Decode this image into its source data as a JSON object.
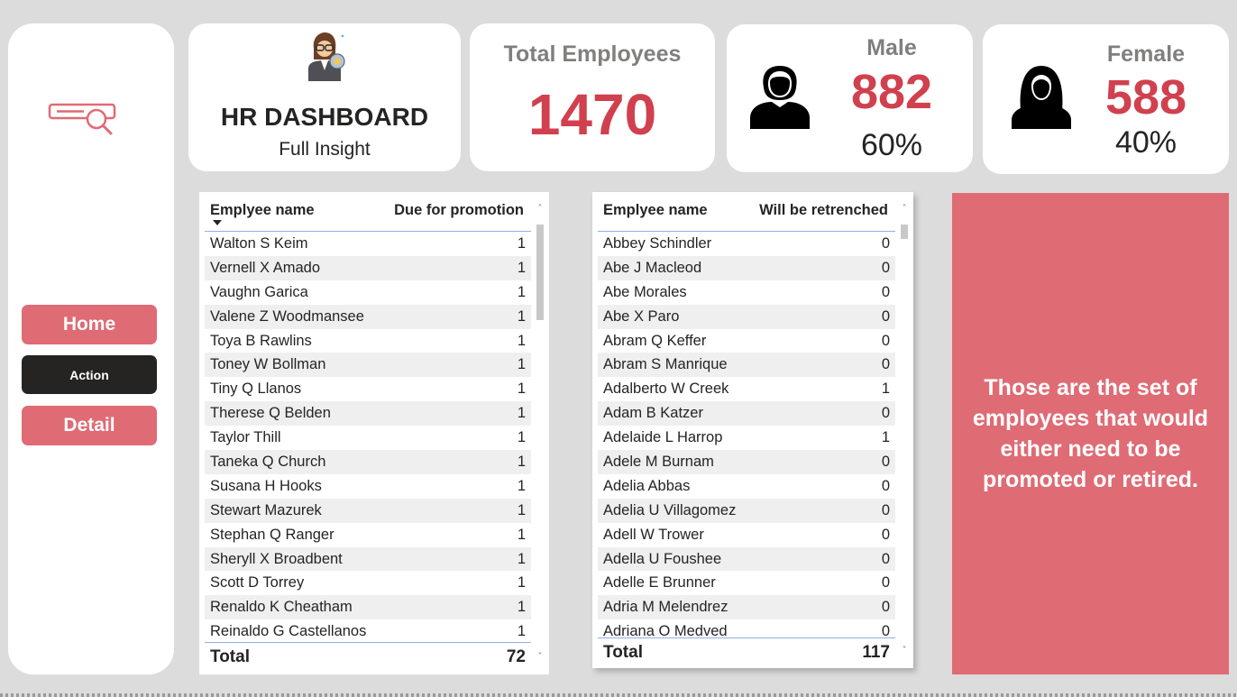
{
  "colors": {
    "accent": "#df6b74",
    "value_red": "#d0404e",
    "dark": "#252423",
    "background": "#dcdcdc"
  },
  "sidebar": {
    "logo_icon": "search-report-icon",
    "nav": {
      "home": "Home",
      "action": "Action",
      "detail": "Detail"
    }
  },
  "title_card": {
    "icon": "hr-manager-avatar-icon",
    "title": "HR DASHBOARD",
    "subtitle": "Full Insight"
  },
  "kpis": {
    "total": {
      "label": "Total Employees",
      "value": "1470"
    },
    "male": {
      "label": "Male",
      "value": "882",
      "percent": "60%",
      "icon": "male-person-icon"
    },
    "female": {
      "label": "Female",
      "value": "588",
      "percent": "40%",
      "icon": "female-person-icon"
    }
  },
  "promotion_table": {
    "columns": [
      "Emplyee name",
      "Due for promotion"
    ],
    "rows": [
      [
        "Walton S Keim",
        "1"
      ],
      [
        "Vernell X Amado",
        "1"
      ],
      [
        "Vaughn Garica",
        "1"
      ],
      [
        "Valene Z Woodmansee",
        "1"
      ],
      [
        "Toya B Rawlins",
        "1"
      ],
      [
        "Toney W Bollman",
        "1"
      ],
      [
        "Tiny Q Llanos",
        "1"
      ],
      [
        "Therese Q Belden",
        "1"
      ],
      [
        "Taylor Thill",
        "1"
      ],
      [
        "Taneka Q Church",
        "1"
      ],
      [
        "Susana H Hooks",
        "1"
      ],
      [
        "Stewart Mazurek",
        "1"
      ],
      [
        "Stephan Q Ranger",
        "1"
      ],
      [
        "Sheryll X Broadbent",
        "1"
      ],
      [
        "Scott D Torrey",
        "1"
      ],
      [
        "Renaldo K Cheatham",
        "1"
      ],
      [
        "Reinaldo G Castellanos",
        "1"
      ]
    ],
    "total_label": "Total",
    "total_value": "72"
  },
  "retrench_table": {
    "columns": [
      "Emplyee name",
      "Will be retrenched"
    ],
    "rows": [
      [
        "Abbey Schindler",
        "0"
      ],
      [
        "Abe J Macleod",
        "0"
      ],
      [
        "Abe Morales",
        "0"
      ],
      [
        "Abe X Paro",
        "0"
      ],
      [
        "Abram Q Keffer",
        "0"
      ],
      [
        "Abram S Manrique",
        "0"
      ],
      [
        "Adalberto W Creek",
        "1"
      ],
      [
        "Adam B Katzer",
        "0"
      ],
      [
        "Adelaide L Harrop",
        "1"
      ],
      [
        "Adele M Burnam",
        "0"
      ],
      [
        "Adelia Abbas",
        "0"
      ],
      [
        "Adelia U Villagomez",
        "0"
      ],
      [
        "Adell W Trower",
        "0"
      ],
      [
        "Adella U Foushee",
        "0"
      ],
      [
        "Adelle E Brunner",
        "0"
      ],
      [
        "Adria M Melendrez",
        "0"
      ],
      [
        "Adriana O Medved",
        "0"
      ]
    ],
    "total_label": "Total",
    "total_value": "117"
  },
  "info_box": {
    "text": "Those are the set of employees that would either need to be promoted or retired."
  }
}
